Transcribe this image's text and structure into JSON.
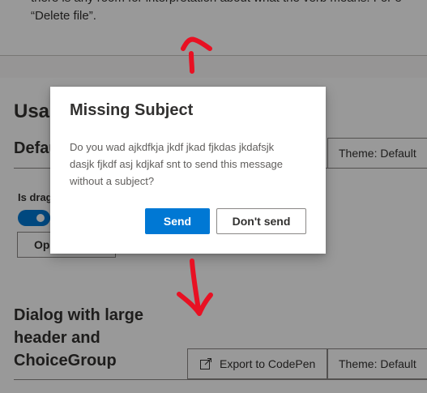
{
  "page": {
    "intro_line1": "there is any room for interpretation about what the verb means. For e",
    "intro_line2": "“Delete file”.",
    "section_heading": "Usag",
    "example_heading": "Defau",
    "theme_button_1": "Theme: Default",
    "toggle_label": "Is drag",
    "open_button": "Op",
    "example2_heading": [
      "Dialog with large",
      "header and",
      "ChoiceGroup"
    ],
    "codepen_button": "Export to CodePen",
    "theme_button_2": "Theme: Default"
  },
  "dialog": {
    "title": "Missing Subject",
    "body_lines": [
      "Do you wad ajkdfkja jkdf jkad fjkdas jkdafsjk",
      "dasjk fjkdf asj kdjkaf snt to send this message",
      "without a subject?"
    ],
    "primary_button": "Send",
    "secondary_button": "Don't send"
  },
  "icons": {
    "codepen": "export-icon"
  },
  "colors": {
    "accent": "#0078d4",
    "annotation": "#e81123",
    "overlay": "rgba(0,0,0,0.4)"
  }
}
